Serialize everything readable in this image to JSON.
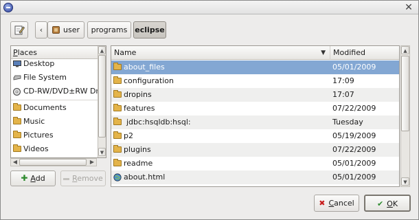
{
  "window": {
    "title": ""
  },
  "toolbar": {
    "edit_icon": "pencil-paper-icon"
  },
  "breadcrumb": {
    "back": "‹",
    "items": [
      "user",
      "programs",
      "eclipse"
    ]
  },
  "places": {
    "header_prefix": "P",
    "header_rest": "laces",
    "items": [
      {
        "label": "Desktop",
        "icon": "desktop-icon"
      },
      {
        "label": "File System",
        "icon": "drive-icon"
      },
      {
        "label": "CD-RW/DVD±RW Drive",
        "icon": "cdrom-icon"
      },
      {
        "label": "Documents",
        "icon": "folder-icon"
      },
      {
        "label": "Music",
        "icon": "folder-icon"
      },
      {
        "label": "Pictures",
        "icon": "folder-icon"
      },
      {
        "label": "Videos",
        "icon": "folder-icon"
      }
    ],
    "add_prefix": "A",
    "add_rest": "dd",
    "remove_prefix": "R",
    "remove_rest": "emove"
  },
  "files": {
    "col_name": "Name",
    "col_modified": "Modified",
    "rows": [
      {
        "name": "about_files",
        "modified": "05/01/2009",
        "icon": "folder-icon"
      },
      {
        "name": "configuration",
        "modified": "17:09",
        "icon": "folder-icon"
      },
      {
        "name": "dropins",
        "modified": "17:07",
        "icon": "folder-icon"
      },
      {
        "name": "features",
        "modified": "07/22/2009",
        "icon": "folder-icon"
      },
      {
        "name": "jdbc:hsqldb:hsql:",
        "modified": "Tuesday",
        "icon": "folder-icon"
      },
      {
        "name": "p2",
        "modified": "05/19/2009",
        "icon": "folder-icon"
      },
      {
        "name": "plugins",
        "modified": "07/22/2009",
        "icon": "folder-icon"
      },
      {
        "name": "readme",
        "modified": "05/01/2009",
        "icon": "folder-icon"
      },
      {
        "name": "about.html",
        "modified": "05/01/2009",
        "icon": "html-file-icon"
      }
    ]
  },
  "dialog": {
    "cancel_prefix": "C",
    "cancel_rest": "ancel",
    "ok_prefix": "O",
    "ok_rest": "K"
  }
}
